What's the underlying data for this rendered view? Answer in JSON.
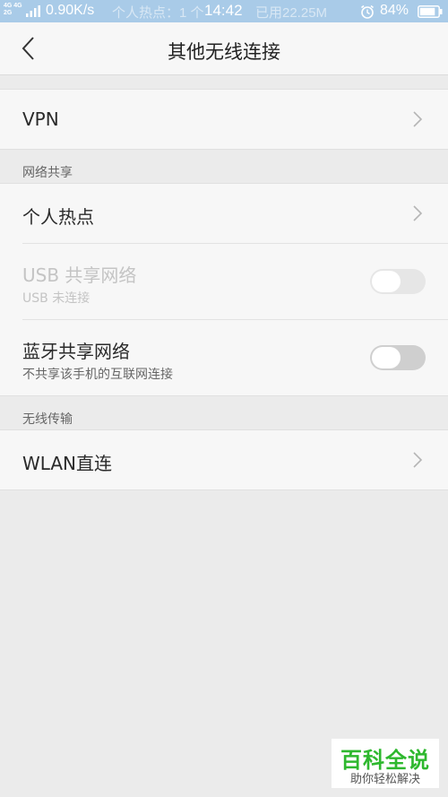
{
  "status_bar": {
    "network_top": "4G 4G",
    "network_bottom": "2G",
    "speed": "0.90K/s",
    "hotspot_text": "个人热点：1 个",
    "time": "14:42",
    "data_used": "已用22.25M",
    "battery_percent": "84%"
  },
  "header": {
    "title": "其他无线连接"
  },
  "vpn": {
    "label": "VPN"
  },
  "sharing_section": {
    "label": "网络共享",
    "hotspot": {
      "label": "个人热点"
    },
    "usb": {
      "label": "USB 共享网络",
      "sublabel": "USB 未连接",
      "enabled": false,
      "on": false
    },
    "bluetooth": {
      "label": "蓝牙共享网络",
      "sublabel": "不共享该手机的互联网连接",
      "on": false
    }
  },
  "wireless_section": {
    "label": "无线传输",
    "wlan_direct": {
      "label": "WLAN直连"
    }
  },
  "watermark": {
    "main": "百科全说",
    "sub": "助你轻松解决"
  },
  "colors": {
    "status_bar_bg": "#a9cbe8",
    "page_bg": "#ebebeb",
    "card_bg": "#f7f7f7",
    "watermark_green": "#2eb82e"
  }
}
